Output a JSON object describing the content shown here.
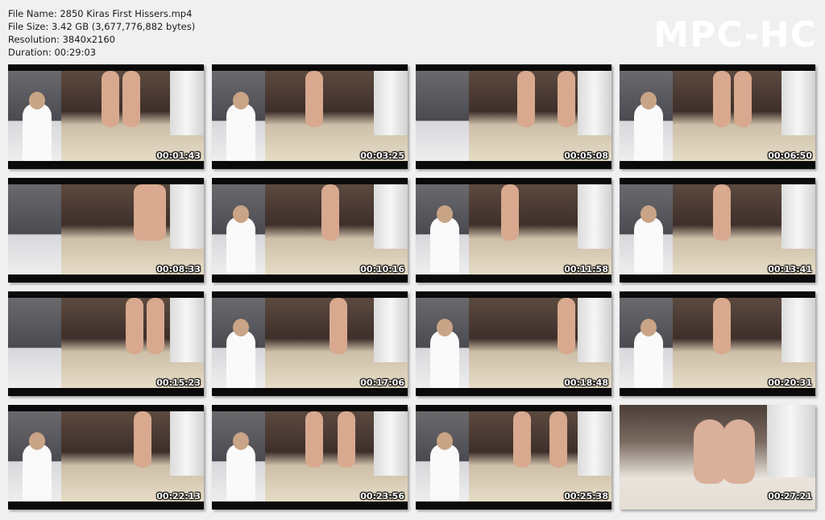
{
  "file_info": {
    "name": "File Name: 2850 Kiras First Hissers.mp4",
    "size": "File Size: 3.42 GB (3,677,776,882 bytes)",
    "resolution": "Resolution: 3840x2160",
    "duration": "Duration: 00:29:03"
  },
  "logo": "MPC-HC",
  "thumbnails": [
    {
      "time": "00:01:43"
    },
    {
      "time": "00:03:25"
    },
    {
      "time": "00:05:08"
    },
    {
      "time": "00:06:50"
    },
    {
      "time": "00:08:33"
    },
    {
      "time": "00:10:16"
    },
    {
      "time": "00:11:58"
    },
    {
      "time": "00:13:41"
    },
    {
      "time": "00:15:23"
    },
    {
      "time": "00:17:06"
    },
    {
      "time": "00:18:48"
    },
    {
      "time": "00:20:31"
    },
    {
      "time": "00:22:13"
    },
    {
      "time": "00:23:56"
    },
    {
      "time": "00:25:38"
    },
    {
      "time": "00:27:21"
    }
  ]
}
